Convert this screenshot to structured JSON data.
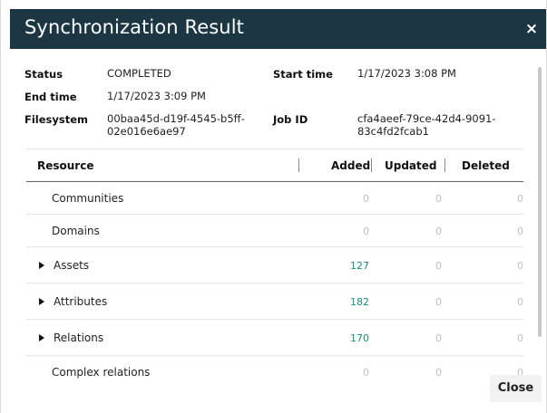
{
  "dialog": {
    "title": "Synchronization Result",
    "close_icon": "×",
    "close_button": "Close"
  },
  "meta": {
    "status_label": "Status",
    "status_value": "COMPLETED",
    "start_time_label": "Start time",
    "start_time_value": "1/17/2023 3:08 PM",
    "end_time_label": "End time",
    "end_time_value": "1/17/2023 3:09 PM",
    "filesystem_label": "Filesystem",
    "filesystem_value_line1": "00baa45d-d19f-4545-b5ff-",
    "filesystem_value_line2": "02e016e6ae97",
    "job_id_label": "Job ID",
    "job_id_value_line1": "cfa4aeef-79ce-42d4-9091-",
    "job_id_value_line2": "83c4fd2fcab1"
  },
  "table": {
    "headers": {
      "resource": "Resource",
      "added": "Added",
      "updated": "Updated",
      "deleted": "Deleted"
    },
    "rows": [
      {
        "name": "Communities",
        "added": "0",
        "updated": "0",
        "deleted": "0",
        "expandable": false
      },
      {
        "name": "Domains",
        "added": "0",
        "updated": "0",
        "deleted": "0",
        "expandable": false
      },
      {
        "name": "Assets",
        "added": "127",
        "updated": "0",
        "deleted": "0",
        "expandable": true
      },
      {
        "name": "Attributes",
        "added": "182",
        "updated": "0",
        "deleted": "0",
        "expandable": true
      },
      {
        "name": "Relations",
        "added": "170",
        "updated": "0",
        "deleted": "0",
        "expandable": true
      },
      {
        "name": "Complex relations",
        "added": "0",
        "updated": "0",
        "deleted": "0",
        "expandable": false
      }
    ]
  },
  "colors": {
    "titlebar": "#1c3644",
    "positive_number": "#1f8a78",
    "zero_number": "#bdbdbd"
  },
  "icons": {
    "expand": "caret-right-icon",
    "close": "close-icon"
  }
}
